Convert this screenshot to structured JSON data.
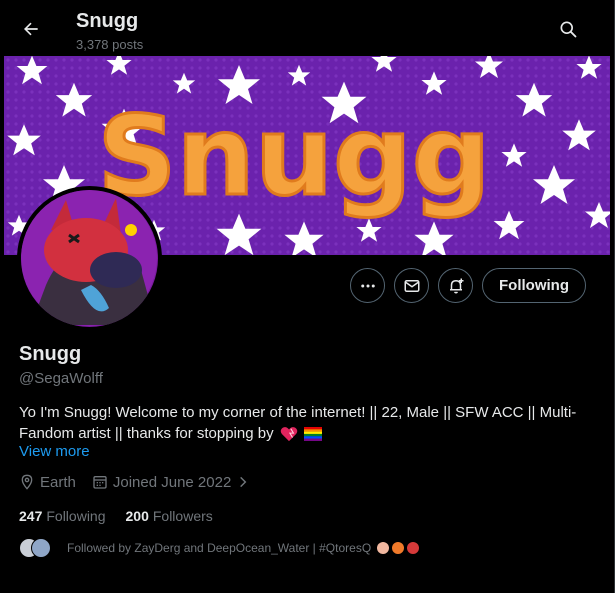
{
  "header": {
    "name": "Snugg",
    "post_count": "3,378 posts",
    "back_icon": "arrow-left-icon",
    "search_icon": "search-icon"
  },
  "banner": {
    "text": "Snugg",
    "background_color": "#6a1ca8",
    "text_color": "#f5a23d"
  },
  "profile": {
    "display_name": "Snugg",
    "handle": "@SegaWolff",
    "bio_line1": "Yo I'm Snugg! Welcome to my corner of the internet! || 22, Male || SFW ACC || Multi-",
    "bio_line2": "Fandom artist || thanks for stopping by",
    "view_more": "View more",
    "location": "Earth",
    "joined": "Joined June 2022"
  },
  "actions": {
    "more_icon": "more-dots-icon",
    "message_icon": "mail-icon",
    "notify_icon": "bell-plus-icon",
    "follow_label": "Following"
  },
  "stats": {
    "following_count": "247",
    "following_label": "Following",
    "followers_count": "200",
    "followers_label": "Followers"
  },
  "followed_by": {
    "text": "Followed by ZayDerg and DeepOcean_Water | #QtoresQ"
  },
  "colors": {
    "accent_link": "#1d9bf0",
    "muted_text": "#71767b",
    "primary_text": "#e7e9ea",
    "border": "#536471"
  }
}
